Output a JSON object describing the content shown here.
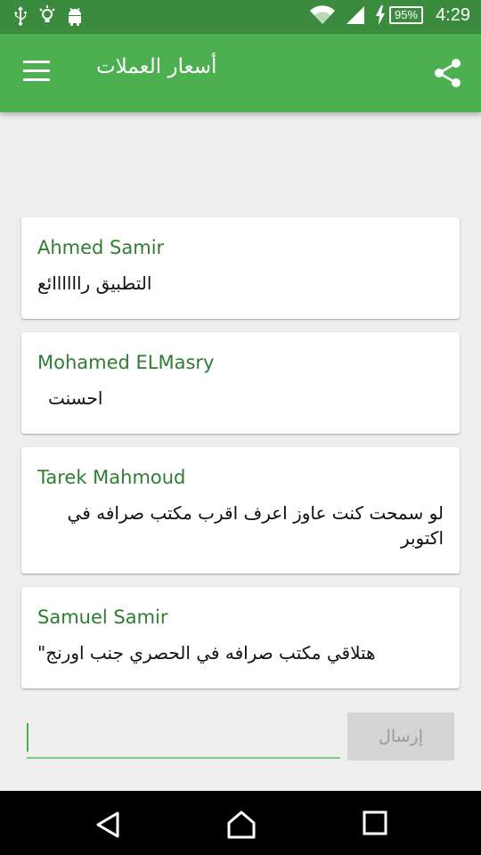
{
  "status_bar": {
    "time": "4:29",
    "battery_percent": "95%",
    "icons": [
      "usb-icon",
      "lightbulb-icon",
      "android-icon",
      "wifi-icon",
      "signal-icon",
      "charging-icon",
      "battery-icon"
    ]
  },
  "app_bar": {
    "title": "أسعار العملات",
    "menu_icon": "hamburger-menu-icon",
    "share_icon": "share-icon",
    "color": "#4caf50"
  },
  "comments": [
    {
      "author": "Ahmed Samir",
      "message": "التطبيق راااااائع"
    },
    {
      "author": "Mohamed ELMasry",
      "message": "احسنت"
    },
    {
      "author": "Tarek Mahmoud",
      "message": "لو سمحت كنت عاوز اعرف اقرب مكتب صرافه في اكتوبر"
    },
    {
      "author": "Samuel Samir",
      "message": "هتلاقي  مكتب  صرافه  في  الحصري  جنب اورنج\""
    }
  ],
  "composer": {
    "input_value": "",
    "send_label": "إرسال"
  },
  "nav_bar": {
    "icons": [
      "back-icon",
      "home-icon",
      "recents-icon"
    ]
  },
  "colors": {
    "accent": "#4caf50",
    "author_text": "#2e7d32",
    "status_bar": "#3b8b3e"
  }
}
